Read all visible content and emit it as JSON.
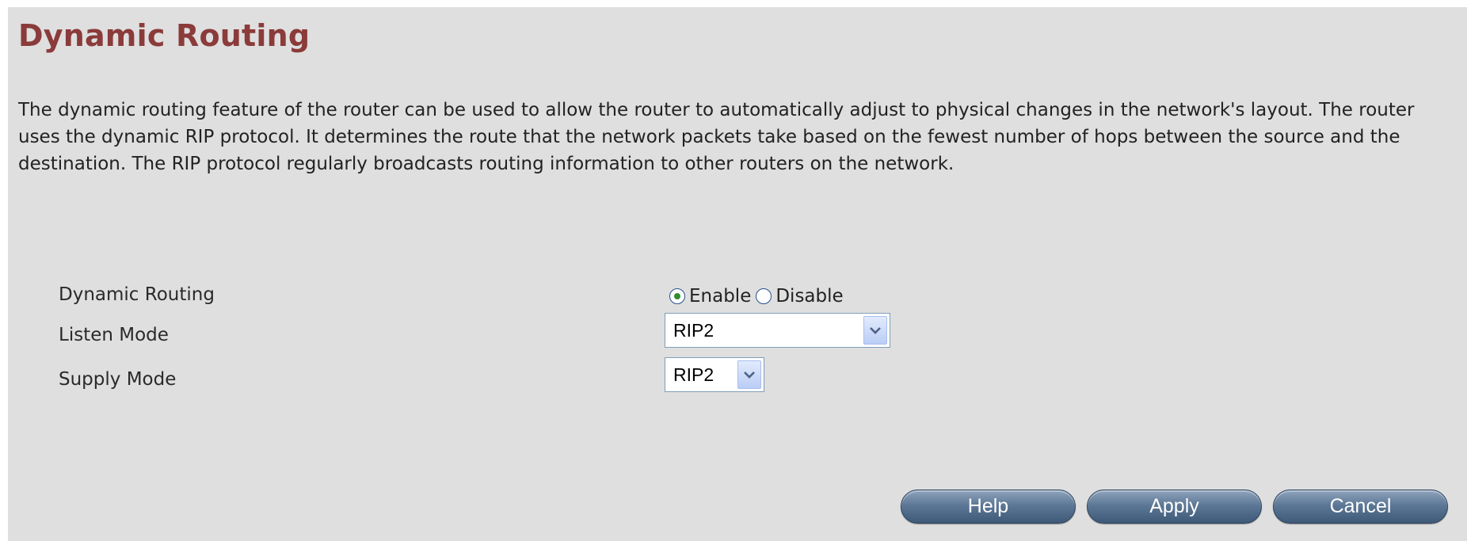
{
  "page": {
    "title": "Dynamic Routing",
    "description": "The dynamic routing feature of the router can be used to allow the router to automatically adjust to physical changes in the network's layout. The router uses the dynamic RIP protocol. It determines the route that the network packets take based on the fewest number of hops between the source and the destination. The RIP protocol regularly broadcasts routing information to other routers on the network."
  },
  "form": {
    "dynamic_routing": {
      "label": "Dynamic Routing",
      "options": [
        "Enable",
        "Disable"
      ],
      "selected": "Enable"
    },
    "listen_mode": {
      "label": "Listen Mode",
      "value": "RIP2"
    },
    "supply_mode": {
      "label": "Supply Mode",
      "value": "RIP2"
    }
  },
  "buttons": {
    "help": "Help",
    "apply": "Apply",
    "cancel": "Cancel"
  },
  "colors": {
    "title": "#8a3b3a",
    "panel_background": "#dfdfdf",
    "button": "#4f6a8a",
    "radio_selected": "#2f8f2f"
  }
}
